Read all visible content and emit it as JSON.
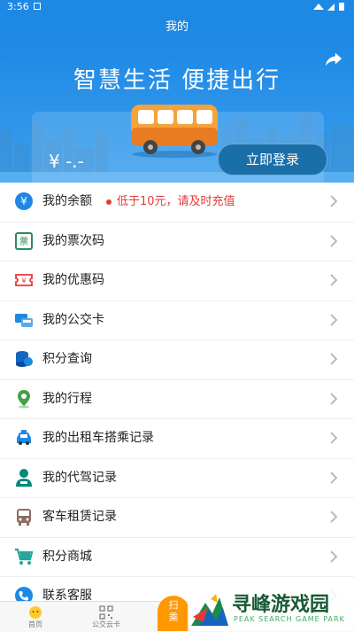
{
  "status": {
    "time": "3:56"
  },
  "header": {
    "title": "我的"
  },
  "hero": {
    "slogan": "智慧生活  便捷出行",
    "balance": "¥ -.-",
    "login_label": "立即登录"
  },
  "menu": [
    {
      "label": "我的余额",
      "icon": "yen-icon",
      "note": "低于10元，请及时充值"
    },
    {
      "label": "我的票次码",
      "icon": "ticket-icon"
    },
    {
      "label": "我的优惠码",
      "icon": "coupon-icon"
    },
    {
      "label": "我的公交卡",
      "icon": "bus-card-icon"
    },
    {
      "label": "积分查询",
      "icon": "coins-icon"
    },
    {
      "label": "我的行程",
      "icon": "location-pin-icon"
    },
    {
      "label": "我的出租车搭乘记录",
      "icon": "taxi-icon"
    },
    {
      "label": "我的代驾记录",
      "icon": "driver-icon"
    },
    {
      "label": "客车租赁记录",
      "icon": "coach-icon"
    },
    {
      "label": "积分商城",
      "icon": "cart-icon"
    },
    {
      "label": "联系客服",
      "icon": "phone-icon"
    }
  ],
  "tabbar": {
    "home": "首页",
    "card": "公交云卡",
    "scan": "扫\n乘"
  },
  "watermark": {
    "title": "寻峰游戏园",
    "subtitle": "PEAK SEARCH GAME PARK"
  },
  "colors": {
    "primary": "#1e88e5",
    "accent": "#ff9800",
    "warning": "#e53935"
  }
}
